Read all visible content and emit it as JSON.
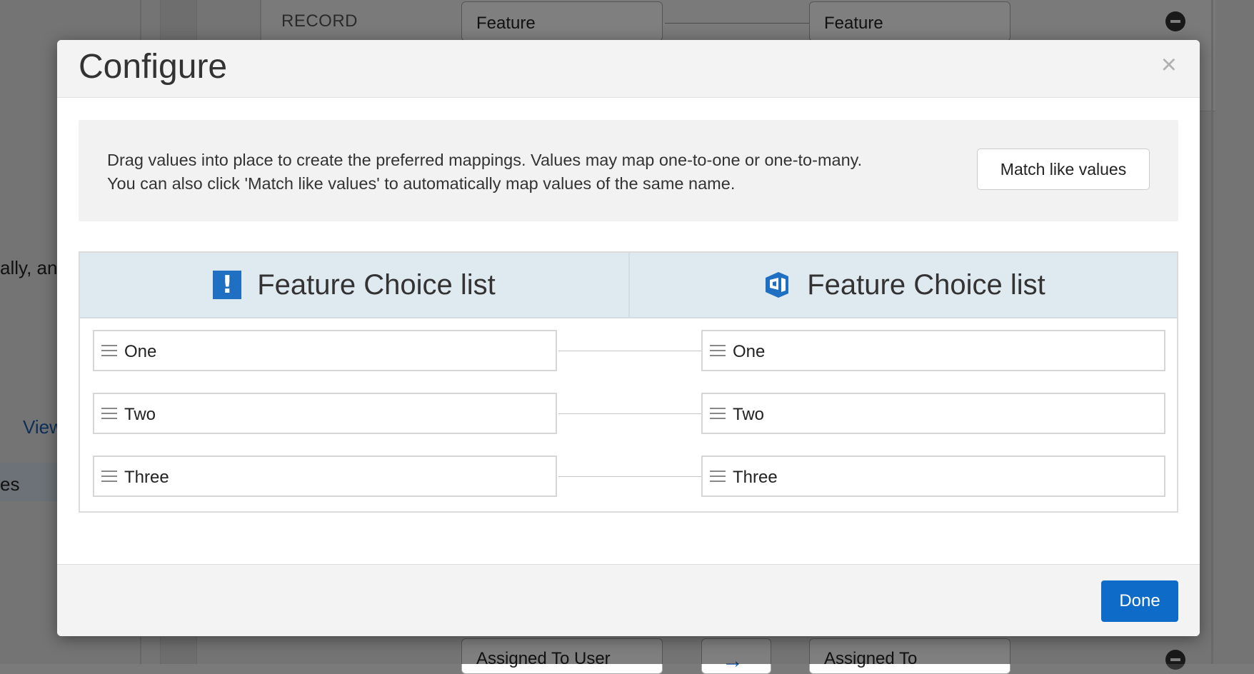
{
  "background": {
    "record_label": "RECORD",
    "top_field_left": "Feature",
    "top_field_right": "Feature",
    "partial_text_1": "ally, an",
    "partial_link": "View",
    "partial_text_2": "es",
    "bottom_field_left": "Assigned To User",
    "bottom_field_right": "Assigned To"
  },
  "modal": {
    "title": "Configure",
    "close_symbol": "×",
    "info": {
      "text_line1": "Drag values into place to create the preferred mappings. Values may map one-to-one or one-to-many.",
      "text_line2": "You can also click 'Match like values' to automatically map values of the same name.",
      "match_button": "Match like values"
    },
    "mapping": {
      "left_header": "Feature Choice list",
      "right_header": "Feature Choice list",
      "left_icon": "exclamation-icon",
      "right_icon": "azure-devops-icon",
      "left_values": [
        "One",
        "Two",
        "Three"
      ],
      "right_values": [
        "One",
        "Two",
        "Three"
      ]
    },
    "done_button": "Done"
  }
}
